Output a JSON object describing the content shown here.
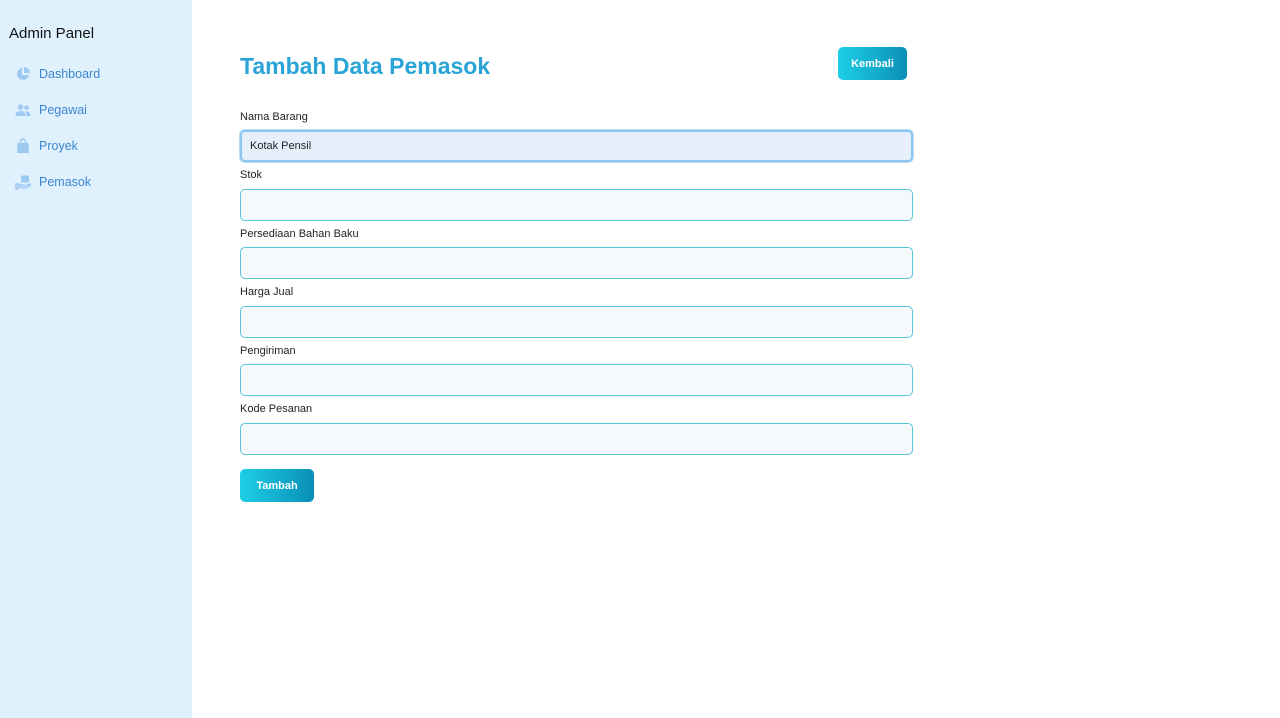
{
  "sidebar": {
    "brand": "Admin Panel",
    "items": [
      {
        "label": "Dashboard",
        "icon": "pie-chart-icon"
      },
      {
        "label": "Pegawai",
        "icon": "users-icon"
      },
      {
        "label": "Proyek",
        "icon": "shopping-bag-icon"
      },
      {
        "label": "Pemasok",
        "icon": "hand-holding-box-icon"
      }
    ]
  },
  "main": {
    "title": "Tambah Data Pemasok",
    "back_label": "Kembali",
    "submit_label": "Tambah",
    "fields": [
      {
        "label": "Nama Barang",
        "value": "Kotak Pensil"
      },
      {
        "label": "Stok",
        "value": ""
      },
      {
        "label": "Persediaan Bahan Baku",
        "value": ""
      },
      {
        "label": "Harga Jual",
        "value": ""
      },
      {
        "label": "Pengiriman",
        "value": ""
      },
      {
        "label": "Kode Pesanan",
        "value": ""
      }
    ]
  },
  "colors": {
    "sidebar_bg": "#dff1fd",
    "accent": "#2aa3d6",
    "nav_text": "#3d86cf",
    "icon": "#9ec9f0",
    "button_gradient_start": "#1ecfe6",
    "button_gradient_end": "#0a8fb7"
  }
}
